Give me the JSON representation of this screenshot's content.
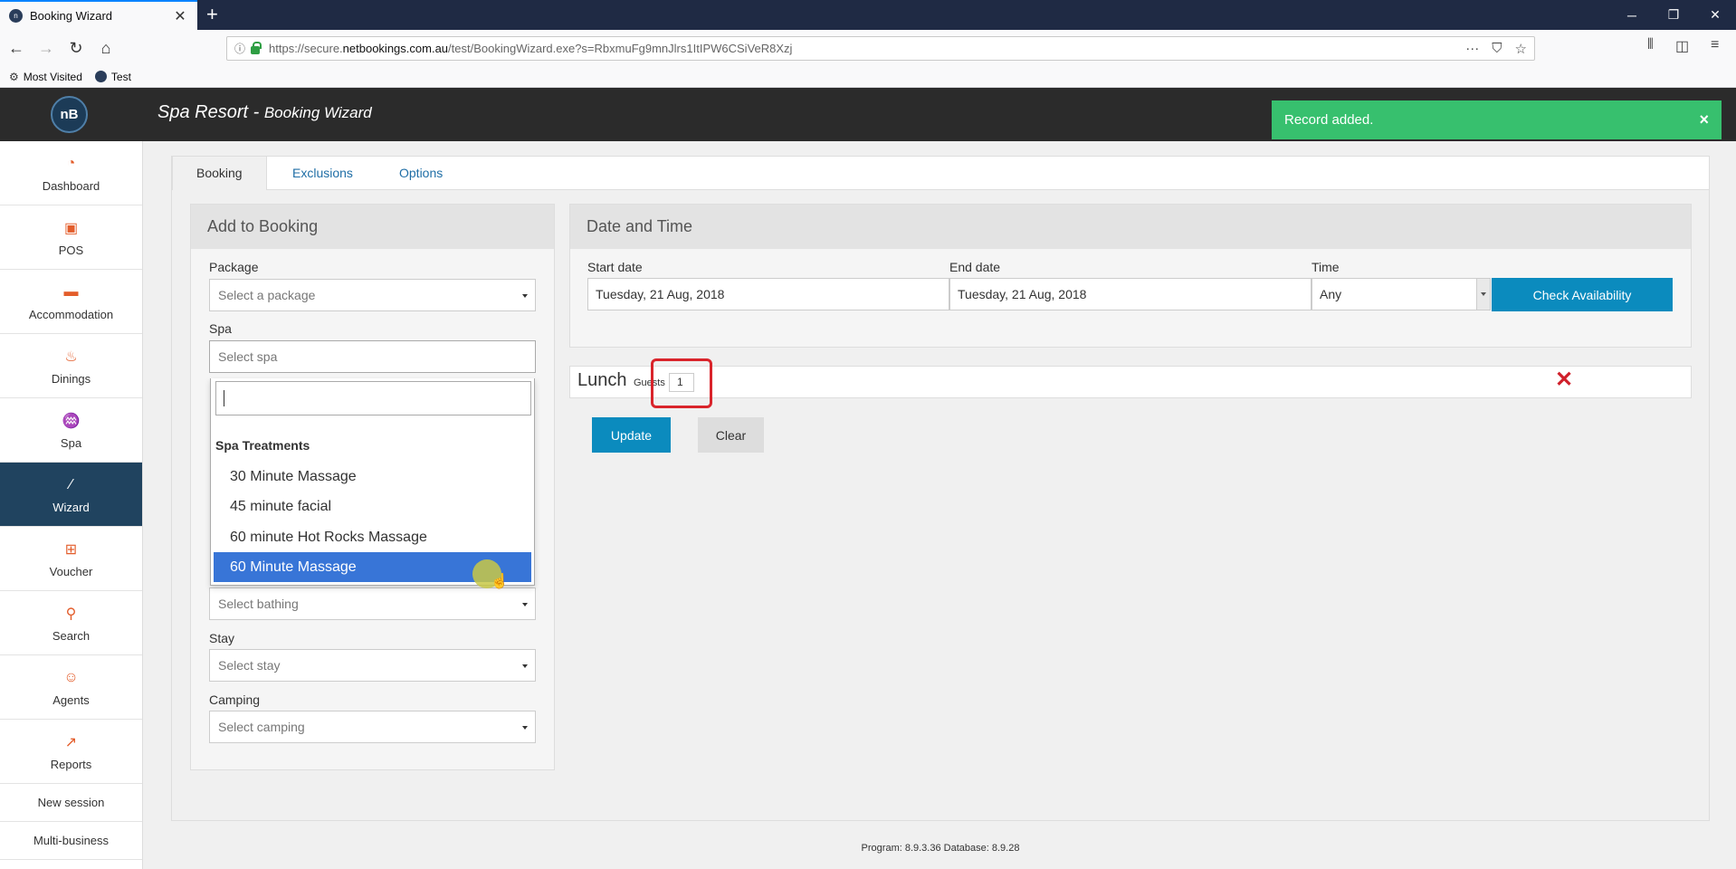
{
  "browser": {
    "tab_title": "Booking Wizard",
    "url_prefix": "https://secure.",
    "url_domain": "netbookings.com.au",
    "url_path": "/test/BookingWizard.exe?s=RbxmuFg9mnJlrs1ItIPW6CSiVeR8Xzj",
    "bookmarks": [
      "Most Visited",
      "Test"
    ]
  },
  "app": {
    "logo_text": "nB",
    "title": "Spa Resort",
    "subtitle": "Booking Wizard",
    "toast": "Record added.",
    "toast_close": "×"
  },
  "sidebar": {
    "items": [
      {
        "label": "Dashboard",
        "icon": "gauge-icon"
      },
      {
        "label": "POS",
        "icon": "pos-icon"
      },
      {
        "label": "Accommodation",
        "icon": "bed-icon"
      },
      {
        "label": "Dinings",
        "icon": "dining-icon"
      },
      {
        "label": "Spa",
        "icon": "spa-icon"
      },
      {
        "label": "Wizard",
        "icon": "wand-icon"
      },
      {
        "label": "Voucher",
        "icon": "gift-icon"
      },
      {
        "label": "Search",
        "icon": "search-icon"
      },
      {
        "label": "Agents",
        "icon": "agent-icon"
      },
      {
        "label": "Reports",
        "icon": "chart-icon"
      }
    ],
    "links": [
      "New session",
      "Multi-business"
    ]
  },
  "tabs": [
    "Booking",
    "Exclusions",
    "Options"
  ],
  "add_panel": {
    "title": "Add to Booking",
    "package_label": "Package",
    "package_placeholder": "Select a package",
    "spa_label": "Spa",
    "spa_placeholder": "Select spa",
    "bathing_placeholder": "Select bathing",
    "stay_label": "Stay",
    "stay_placeholder": "Select stay",
    "camping_label": "Camping",
    "camping_placeholder": "Select camping"
  },
  "spa_dropdown": {
    "group": "Spa Treatments",
    "options": [
      "30 Minute Massage",
      "45 minute facial",
      "60 minute Hot Rocks Massage",
      "60 Minute Massage"
    ],
    "highlighted": "60 Minute Massage"
  },
  "datetime_panel": {
    "title": "Date and Time",
    "start_label": "Start date",
    "start_value": "Tuesday, 21 Aug, 2018",
    "end_label": "End date",
    "end_value": "Tuesday, 21 Aug, 2018",
    "time_label": "Time",
    "time_value": "Any",
    "check_button": "Check Availability"
  },
  "booking_item": {
    "title": "Lunch",
    "guests_label": "Guests",
    "guests_value": "1"
  },
  "actions": {
    "update": "Update",
    "clear": "Clear"
  },
  "footer": "Program: 8.9.3.36 Database: 8.9.28",
  "colors": {
    "accent": "#0b8bbe",
    "sidebar_active": "#20435f",
    "toast": "#37c06e",
    "highlight": "#3875d7"
  }
}
